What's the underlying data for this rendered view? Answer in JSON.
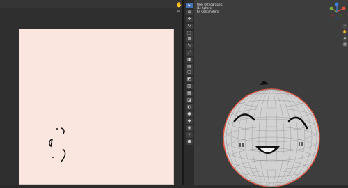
{
  "viewport": {
    "overlay_lines": [
      "User Orthographic",
      "(1) Sphere",
      "64 Centimeters"
    ]
  },
  "toolbar": {
    "tools": [
      {
        "name": "select-tool",
        "icon": "cursor-icon",
        "glyph": "▸",
        "active": true
      },
      {
        "name": "cursor-tool",
        "icon": "crosshair-icon",
        "glyph": "⊕",
        "active": false
      },
      {
        "name": "move-tool",
        "icon": "move-icon",
        "glyph": "✥",
        "active": false
      },
      {
        "name": "rotate-tool",
        "icon": "rotate-icon",
        "glyph": "↻",
        "active": false
      },
      {
        "name": "scale-tool",
        "icon": "scale-icon",
        "glyph": "⬚",
        "active": false
      },
      {
        "name": "transform-tool",
        "icon": "transform-icon",
        "glyph": "⊞",
        "active": false
      },
      {
        "name": "annotate-tool",
        "icon": "pencil-icon",
        "glyph": "✎",
        "active": false
      },
      {
        "name": "measure-tool",
        "icon": "ruler-icon",
        "glyph": "⟋",
        "active": false
      },
      {
        "name": "add-cube-tool",
        "icon": "cube-icon",
        "glyph": "▣",
        "active": false
      },
      {
        "name": "extrude-tool",
        "icon": "extrude-icon",
        "glyph": "▤",
        "active": false
      },
      {
        "name": "inset-tool",
        "icon": "inset-icon",
        "glyph": "▢",
        "active": false
      },
      {
        "name": "bevel-tool",
        "icon": "bevel-icon",
        "glyph": "◩",
        "active": false
      },
      {
        "name": "loop-cut-tool",
        "icon": "loopcut-icon",
        "glyph": "▥",
        "active": false
      },
      {
        "name": "knife-tool",
        "icon": "knife-icon",
        "glyph": "▦",
        "active": false
      },
      {
        "name": "poly-build-tool",
        "icon": "polybuild-icon",
        "glyph": "◪",
        "active": false
      },
      {
        "name": "spin-tool",
        "icon": "spin-icon",
        "glyph": "◐",
        "active": false
      },
      {
        "name": "smooth-tool",
        "icon": "smooth-icon",
        "glyph": "●",
        "active": false
      },
      {
        "name": "edge-slide-tool",
        "icon": "edgeslide-icon",
        "glyph": "◆",
        "active": false
      },
      {
        "name": "shrink-tool",
        "icon": "shrink-icon",
        "glyph": "◉",
        "active": false
      },
      {
        "name": "shear-tool",
        "icon": "shear-icon",
        "glyph": "✧",
        "active": false
      },
      {
        "name": "rip-tool",
        "icon": "rip-icon",
        "glyph": "⬢",
        "active": false
      }
    ]
  },
  "colors": {
    "canvas_bg": "#fae6df",
    "viewport_bg": "#3d3d3d",
    "sphere_fill": "#cfcfcf",
    "selection_outline": "#e0533d",
    "active_tool": "#4772b3"
  }
}
